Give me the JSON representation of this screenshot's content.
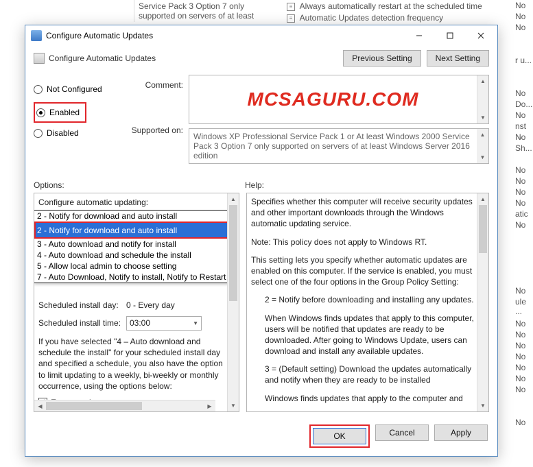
{
  "background": {
    "left_item1": "Service Pack 3 Option 7 only supported on servers of at least",
    "mid_item1": "Always automatically restart at the scheduled time",
    "mid_item2": "Automatic Updates detection frequency",
    "right_fragments": [
      "No",
      "No",
      "No",
      "",
      "",
      "r u...",
      "",
      "",
      "No",
      "Do...",
      "No",
      "nst ...",
      "No",
      "Sh...",
      "",
      "No",
      "No",
      "No",
      "No",
      "atic ...",
      "No",
      "",
      "",
      "",
      "",
      "",
      "No",
      "ule ...",
      "",
      "No",
      "No",
      "No",
      "No",
      "No",
      "No",
      "No",
      "",
      "",
      "No"
    ]
  },
  "dialog": {
    "title": "Configure Automatic Updates",
    "subtitle": "Configure Automatic Updates",
    "prev_btn": "Previous Setting",
    "next_btn": "Next Setting",
    "radio_not_configured": "Not Configured",
    "radio_enabled": "Enabled",
    "radio_disabled": "Disabled",
    "comment_label": "Comment:",
    "watermark": "MCSAGURU.COM",
    "supported_label": "Supported on:",
    "supported_text": "Windows XP Professional Service Pack 1 or At least Windows 2000 Service Pack 3 Option 7 only supported on servers of at least Windows Server 2016 edition",
    "options_label": "Options:",
    "help_label": "Help:"
  },
  "options": {
    "header": "Configure automatic updating:",
    "selected_display": "2 - Notify for download and auto install",
    "items": [
      "2 - Notify for download and auto install",
      "2 - Notify for download and auto install",
      "3 - Auto download and notify for install",
      "4 - Auto download and schedule the install",
      "5 - Allow local admin to choose setting",
      "7 - Auto Download, Notify to install, Notify to Restart"
    ],
    "sched_day_label": "Scheduled install day:",
    "sched_day_value": "0 - Every day",
    "sched_time_label": "Scheduled install time:",
    "sched_time_value": "03:00",
    "paragraph": "If you have selected \"4 – Auto download and schedule the install\" for your scheduled install day and specified a schedule, you also have the option to limit updating to a weekly, bi-weekly or monthly occurrence, using the options below:",
    "every_week": "Every week"
  },
  "help": {
    "p1": "Specifies whether this computer will receive security updates and other important downloads through the Windows automatic updating service.",
    "p2": "Note: This policy does not apply to Windows RT.",
    "p3": "This setting lets you specify whether automatic updates are enabled on this computer. If the service is enabled, you must select one of the four options in the Group Policy Setting:",
    "p4": "2 = Notify before downloading and installing any updates.",
    "p5": "When Windows finds updates that apply to this computer, users will be notified that updates are ready to be downloaded. After going to Windows Update, users can download and install any available updates.",
    "p6": "3 =  (Default setting) Download the updates automatically and notify when they are ready to be installed",
    "p7": "Windows finds updates that apply to the computer and"
  },
  "buttons": {
    "ok": "OK",
    "cancel": "Cancel",
    "apply": "Apply"
  }
}
